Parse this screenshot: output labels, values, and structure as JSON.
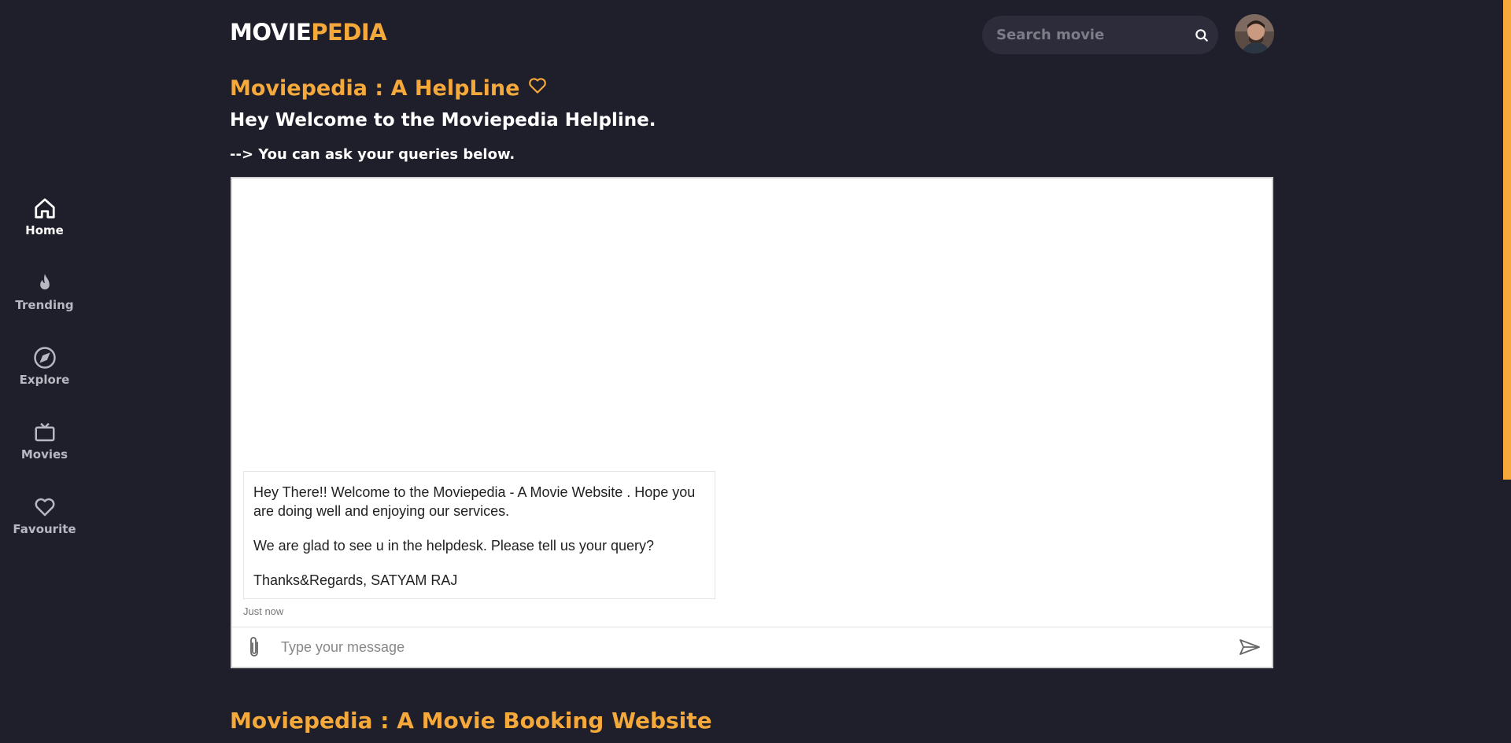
{
  "brand": {
    "logo_part1": "MOVIE",
    "logo_part2": "PEDIA"
  },
  "search": {
    "placeholder": "Search movie"
  },
  "sidebar": {
    "items": [
      {
        "label": "Home",
        "icon": "home-icon",
        "active": true
      },
      {
        "label": "Trending",
        "icon": "flame-icon"
      },
      {
        "label": "Explore",
        "icon": "compass-icon"
      },
      {
        "label": "Movies",
        "icon": "tv-icon"
      },
      {
        "label": "Favourite",
        "icon": "heart-icon"
      }
    ]
  },
  "helpline": {
    "title": "Moviepedia : A HelpLine",
    "welcome": "Hey Welcome to the Moviepedia Helpline.",
    "ask": "--> You can ask your queries below."
  },
  "chat": {
    "message": {
      "para1": "Hey There!! Welcome to the Moviepedia - A Movie Website . Hope you are doing well and enjoying our services.",
      "para2": "We are glad to see u in the helpdesk. Please tell us your query?",
      "para3": "Thanks&Regards, SATYAM RAJ",
      "time": "Just now"
    },
    "input_placeholder": "Type your message"
  },
  "footer_heading": "Moviepedia : A Movie Booking Website",
  "colors": {
    "accent": "#f6a93b",
    "background": "#1f1e2b",
    "search_bg": "#2d2c3a"
  }
}
